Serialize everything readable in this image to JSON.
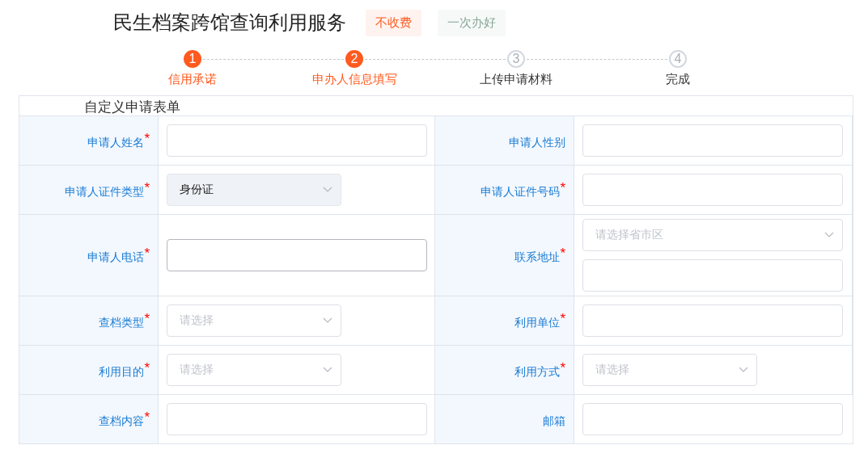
{
  "header": {
    "title": "民生档案跨馆查询利用服务",
    "tags": [
      {
        "label": "不收费",
        "color": "#ff5a1f"
      },
      {
        "label": "一次办好",
        "color": "#86a596"
      }
    ]
  },
  "steps": [
    {
      "number": "1",
      "label": "信用承诺",
      "done": true
    },
    {
      "number": "2",
      "label": "申办人信息填写",
      "done": true
    },
    {
      "number": "3",
      "label": "上传申请材料",
      "done": false
    },
    {
      "number": "4",
      "label": "完成",
      "done": false
    }
  ],
  "form": {
    "title": "自定义申请表单",
    "required_mark": "*",
    "rows": [
      {
        "cells": [
          {
            "label": "申请人姓名",
            "required": true,
            "fields": [
              {
                "kind": "input",
                "focused": false
              }
            ]
          },
          {
            "label": "申请人性别",
            "required": false,
            "fields": [
              {
                "kind": "input",
                "focused": false
              }
            ]
          }
        ]
      },
      {
        "cells": [
          {
            "label": "申请人证件类型",
            "required": true,
            "fields": [
              {
                "kind": "select",
                "value": "身份证",
                "disabled": true
              }
            ]
          },
          {
            "label": "申请人证件号码",
            "required": true,
            "fields": [
              {
                "kind": "input",
                "focused": false
              }
            ]
          }
        ]
      },
      {
        "cells": [
          {
            "label": "申请人电话",
            "required": true,
            "fields": [
              {
                "kind": "input",
                "focused": true
              }
            ]
          },
          {
            "label": "联系地址",
            "required": true,
            "fields": [
              {
                "kind": "wide-select",
                "placeholder": "请选择省市区",
                "disabled": false
              },
              {
                "kind": "input",
                "focused": false
              }
            ]
          }
        ]
      },
      {
        "cells": [
          {
            "label": "查档类型",
            "required": true,
            "fields": [
              {
                "kind": "select",
                "placeholder": "请选择",
                "disabled": false
              }
            ]
          },
          {
            "label": "利用单位",
            "required": true,
            "fields": [
              {
                "kind": "input",
                "focused": false
              }
            ]
          }
        ]
      },
      {
        "cells": [
          {
            "label": "利用目的",
            "required": true,
            "fields": [
              {
                "kind": "select",
                "placeholder": "请选择",
                "disabled": false
              }
            ]
          },
          {
            "label": "利用方式",
            "required": true,
            "fields": [
              {
                "kind": "select",
                "placeholder": "请选择",
                "disabled": false
              }
            ]
          }
        ]
      },
      {
        "cells": [
          {
            "label": "查档内容",
            "required": true,
            "fields": [
              {
                "kind": "input",
                "focused": false
              }
            ]
          },
          {
            "label": "邮箱",
            "required": false,
            "fields": [
              {
                "kind": "input",
                "focused": false
              }
            ]
          }
        ]
      }
    ]
  }
}
